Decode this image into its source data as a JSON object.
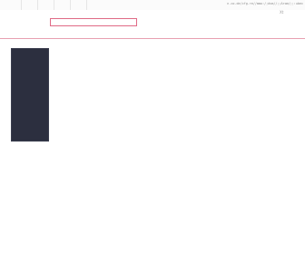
{
  "header": {
    "url_text": "n.co.de/cfg.re//mmo:/;dsm//;;Arom/;;:ubec",
    "right_control_label": "Xt"
  },
  "search": {
    "value": "",
    "placeholder": ""
  },
  "colors": {
    "search_border": "#e06a86",
    "header_rule": "#e8a0b0",
    "panel_background": "#2c2f3f"
  }
}
